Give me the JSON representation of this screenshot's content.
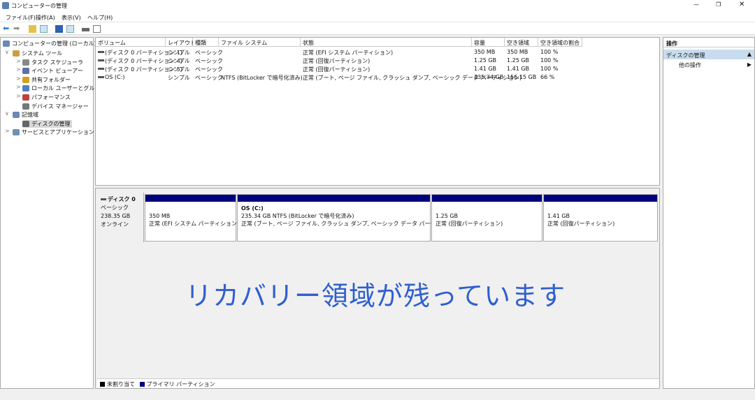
{
  "window": {
    "title": "コンピューターの管理",
    "controls": [
      "minimize",
      "maximize",
      "close"
    ]
  },
  "menu": [
    "ファイル(F)",
    "操作(A)",
    "表示(V)",
    "ヘルプ(H)"
  ],
  "toolbar": [
    "back-icon",
    "forward-icon",
    "up-folder-icon",
    "show-hide-tree-icon",
    "help-icon",
    "properties-icon",
    "disk-icon",
    "console-icon"
  ],
  "tree": {
    "root": "コンピューターの管理 (ローカル)",
    "items": [
      {
        "label": "システム ツール",
        "level": 1,
        "expand": "∨"
      },
      {
        "label": "タスク スケジューラ",
        "level": 2,
        "expand": ">"
      },
      {
        "label": "イベント ビューアー",
        "level": 2,
        "expand": ">"
      },
      {
        "label": "共有フォルダー",
        "level": 2,
        "expand": ">"
      },
      {
        "label": "ローカル ユーザーとグループ",
        "level": 2,
        "expand": ">"
      },
      {
        "label": "パフォーマンス",
        "level": 2,
        "expand": ">"
      },
      {
        "label": "デバイス マネージャー",
        "level": 2,
        "expand": ""
      },
      {
        "label": "記憶域",
        "level": 1,
        "expand": "∨"
      },
      {
        "label": "ディスクの管理",
        "level": 2,
        "expand": "",
        "selected": true
      },
      {
        "label": "サービスとアプリケーション",
        "level": 1,
        "expand": ">"
      }
    ]
  },
  "table": {
    "columns": [
      "ボリューム",
      "レイアウト",
      "種類",
      "ファイル システム",
      "状態",
      "容量",
      "空き領域",
      "空き領域の割合"
    ],
    "rows": [
      [
        "(ディスク 0 パーティション 1)",
        "シンプル",
        "ベーシック",
        "",
        "正常 (EFI システム パーティション)",
        "350 MB",
        "350 MB",
        "100 %"
      ],
      [
        "(ディスク 0 パーティション 4)",
        "シンプル",
        "ベーシック",
        "",
        "正常 (回復パーティション)",
        "1.25 GB",
        "1.25 GB",
        "100 %"
      ],
      [
        "(ディスク 0 パーティション 5)",
        "シンプル",
        "ベーシック",
        "",
        "正常 (回復パーティション)",
        "1.41 GB",
        "1.41 GB",
        "100 %"
      ],
      [
        "OS (C:)",
        "シンプル",
        "ベーシック",
        "NTFS (BitLocker で暗号化済み)",
        "正常 (ブート, ページ ファイル, クラッシュ ダンプ, ベーシック データ パーティション)",
        "235.34 GB",
        "156.15 GB",
        "66 %"
      ]
    ]
  },
  "disk": {
    "name": "ディスク 0",
    "type": "ベーシック",
    "size": "238.35 GB",
    "status": "オンライン",
    "partitions": [
      {
        "name": "",
        "line1": "350 MB",
        "line2": "正常 (EFI システム パーティション)"
      },
      {
        "name": "OS  (C:)",
        "line1": "235.34 GB NTFS (BitLocker で暗号化済み)",
        "line2": "正常 (ブート, ページ ファイル, クラッシュ ダンプ, ベーシック データ パーティション)"
      },
      {
        "name": "",
        "line1": "1.25 GB",
        "line2": "正常 (回復パーティション)"
      },
      {
        "name": "",
        "line1": "1.41 GB",
        "line2": "正常 (回復パーティション)"
      }
    ]
  },
  "overlay": "リカバリー領域が残っています",
  "legend": [
    {
      "label": "未割り当て",
      "color": "#000000"
    },
    {
      "label": "プライマリ パーティション",
      "color": "#00007f"
    }
  ],
  "actions": {
    "header": "操作",
    "section": "ディスクの管理",
    "item": "他の操作"
  },
  "colors": {
    "partition_bar": "#00007f",
    "overlay_text": "#2f5fcf",
    "selected": "#cce4f7"
  }
}
